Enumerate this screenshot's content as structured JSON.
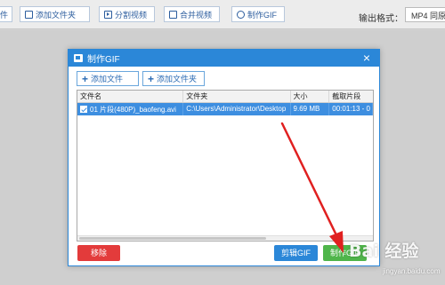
{
  "toolbar": {
    "partial_btn": "件",
    "add_folder": "添加文件夹",
    "split_video": "分割视频",
    "merge_video": "合并视频",
    "make_gif": "制作GIF",
    "output_label": "输出格式：",
    "output_value": "MP4 同原"
  },
  "dialog": {
    "title": "制作GIF",
    "close": "×",
    "add_file": "添加文件",
    "add_folder": "添加文件夹",
    "columns": [
      "文件名",
      "文件夹",
      "大小",
      "截取片段"
    ],
    "rows": [
      {
        "name": "01 片段(480P)_baofeng.avi",
        "folder": "C:\\Users\\Administrator\\Desktop",
        "size": "9.69 MB",
        "clip": "00:01:13 - 0"
      }
    ],
    "remove_btn": "移除",
    "clip_btn": "剪辑GIF",
    "make_btn": "制作GIF"
  },
  "watermark": {
    "main": "Bai 经验",
    "sub": "jingyan.baidu.com"
  },
  "colors": {
    "accent": "#2b87d8",
    "remove": "#e33b3b",
    "make": "#4fb54a",
    "annotation": "#e02020"
  }
}
